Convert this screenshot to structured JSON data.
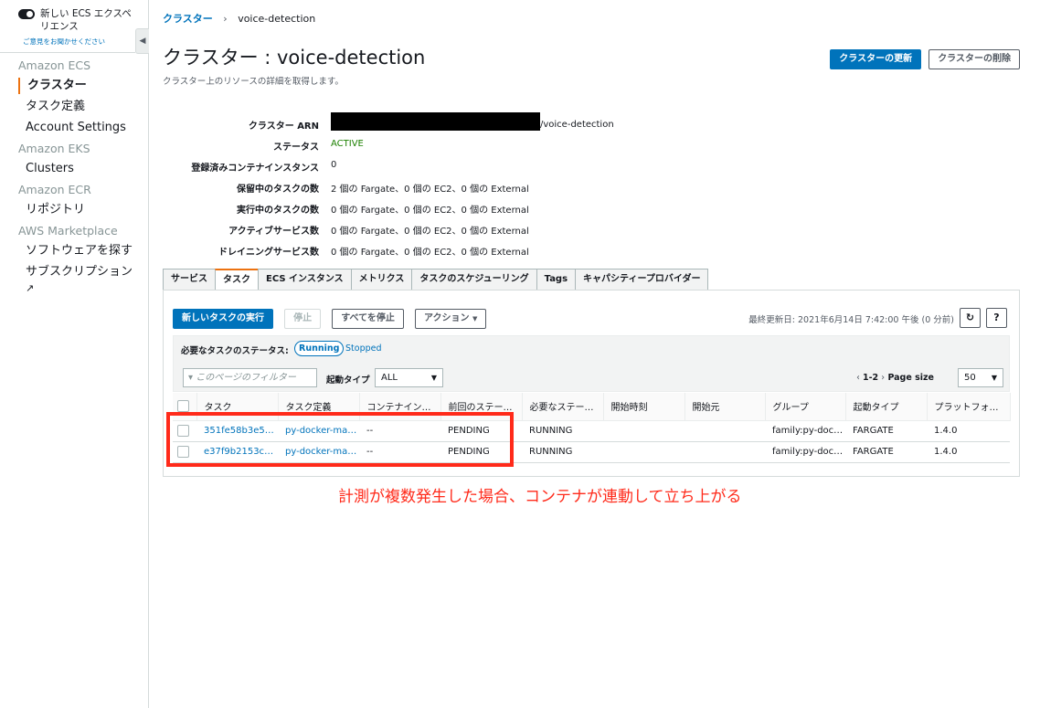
{
  "sidebar": {
    "new_experience_label": "新しい ECS エクスペリエンス",
    "feedback_link": "ご意見をお聞かせください",
    "sections": [
      {
        "heading": "Amazon ECS",
        "items": [
          "クラスター",
          "タスク定義",
          "Account Settings"
        ]
      },
      {
        "heading": "Amazon EKS",
        "items": [
          "Clusters"
        ]
      },
      {
        "heading": "Amazon ECR",
        "items": [
          "リポジトリ"
        ]
      },
      {
        "heading": "AWS Marketplace",
        "items": [
          "ソフトウェアを探す",
          "サブスクリプション"
        ]
      }
    ],
    "active_item": "クラスター"
  },
  "breadcrumb": {
    "root": "クラスター",
    "current": "voice-detection"
  },
  "header": {
    "title": "クラスター : voice-detection",
    "subtitle": "クラスター上のリソースの詳細を取得します。",
    "update_button": "クラスターの更新",
    "delete_button": "クラスターの削除"
  },
  "details": [
    {
      "label": "クラスター ARN",
      "value": "/voice-detection"
    },
    {
      "label": "ステータス",
      "value": "ACTIVE"
    },
    {
      "label": "登録済みコンテナインスタンス",
      "value": "0"
    },
    {
      "label": "保留中のタスクの数",
      "value": "2 個の Fargate、0 個の EC2、0 個の External"
    },
    {
      "label": "実行中のタスクの数",
      "value": "0 個の Fargate、0 個の EC2、0 個の External"
    },
    {
      "label": "アクティブサービス数",
      "value": "0 個の Fargate、0 個の EC2、0 個の External"
    },
    {
      "label": "ドレイニングサービス数",
      "value": "0 個の Fargate、0 個の EC2、0 個の External"
    }
  ],
  "tabs": [
    "サービス",
    "タスク",
    "ECS インスタンス",
    "メトリクス",
    "タスクのスケジューリング",
    "Tags",
    "キャパシティープロバイダー"
  ],
  "active_tab": "タスク",
  "toolbar": {
    "run_task": "新しいタスクの実行",
    "stop": "停止",
    "stop_all": "すべてを停止",
    "actions": "アクション",
    "last_updated": "最終更新日: 2021年6月14日 7:42:00 午後 (0 分前)"
  },
  "filters": {
    "status_label": "必要なタスクのステータス:",
    "running": "Running",
    "stopped": "Stopped",
    "filter_placeholder": "このページのフィルター",
    "launch_type_label": "起動タイプ",
    "launch_type_value": "ALL",
    "pager_range": "1-2",
    "page_size_label": "Page size",
    "page_size_value": "50"
  },
  "table": {
    "columns": [
      "タスク",
      "タスク定義",
      "コンテナイン…",
      "前回のステー…",
      "必要なステー…",
      "開始時刻",
      "開始元",
      "グループ",
      "起動タイプ",
      "プラットフォ…"
    ],
    "rows": [
      [
        "351fe58b3e56…",
        "py-docker-ma…",
        "--",
        "PENDING",
        "RUNNING",
        "",
        "",
        "family:py-dock…",
        "FARGATE",
        "1.4.0"
      ],
      [
        "e37f9b2153c2…",
        "py-docker-ma…",
        "--",
        "PENDING",
        "RUNNING",
        "",
        "",
        "family:py-dock…",
        "FARGATE",
        "1.4.0"
      ]
    ]
  },
  "annotation": "計測が複数発生した場合、コンテナが連動して立ち上がる",
  "colors": {
    "primary": "#0073bb",
    "accent": "#ec7211",
    "active_status": "#1d8102",
    "annotation": "#ff2a1a"
  }
}
